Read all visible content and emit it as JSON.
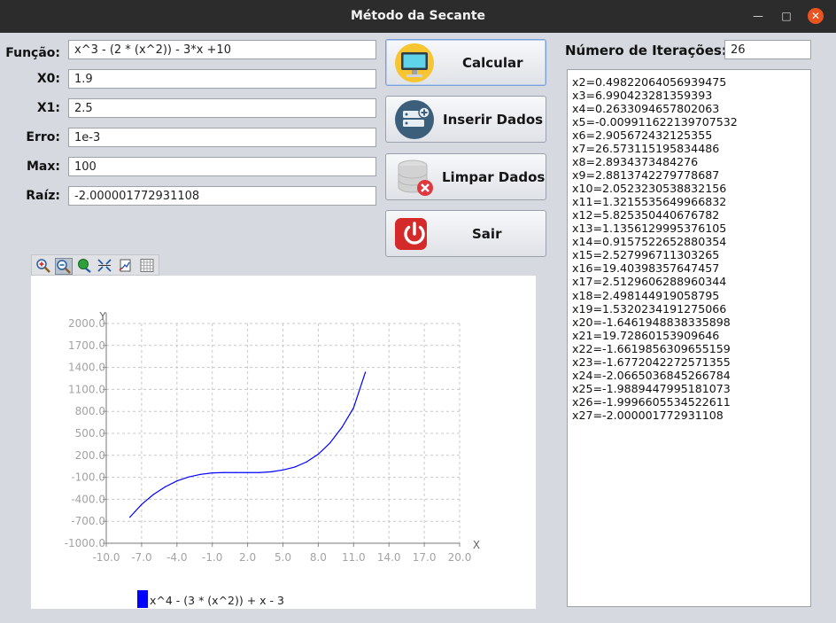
{
  "window": {
    "title": "Método da Secante"
  },
  "form": {
    "funcao": {
      "label": "Função:",
      "value": "x^3 - (2 * (x^2)) - 3*x +10"
    },
    "x0": {
      "label": "X0:",
      "value": "1.9"
    },
    "x1": {
      "label": "X1:",
      "value": "2.5"
    },
    "erro": {
      "label": "Erro:",
      "value": "1e-3"
    },
    "max": {
      "label": "Max:",
      "value": "100"
    },
    "raiz": {
      "label": "Raíz:",
      "value": "-2.000001772931108"
    }
  },
  "buttons": {
    "calcular": "Calcular",
    "inserir": "Inserir Dados",
    "limpar": "Limpar Dados",
    "sair": "Sair"
  },
  "iterations": {
    "label": "Número de Iterações:",
    "value": "26"
  },
  "output_lines": [
    "x2=0.49822064056939475",
    "x3=6.990423281359393",
    "x4=0.2633094657802063",
    "x5=-0.009911622139707532",
    "x6=2.905672432125355",
    "x7=26.573115195834486",
    "x8=2.8934373484276",
    "x9=2.8813742279778687",
    "x10=2.0523230538832156",
    "x11=1.3215535649966832",
    "x12=5.825350440676782",
    "x13=1.1356129995376105",
    "x14=0.9157522652880354",
    "x15=2.527996711303265",
    "x16=19.40398357647457",
    "x17=2.5129606288960344",
    "x18=2.498144919058795",
    "x19=1.5320234191275066",
    "x20=-1.6461948838335898",
    "x21=19.72860153909646",
    "x22=-1.6619856309655159",
    "x23=-1.6772042272571355",
    "x24=-2.0665036845266784",
    "x25=-1.9889447995181073",
    "x26=-1.9996605534522611",
    "x27=-2.000001772931108"
  ],
  "toolbar_icons": [
    "zoom-in-icon",
    "zoom-out-icon",
    "pan-icon",
    "autoscale-icon",
    "export-icon",
    "grid-icon"
  ],
  "chart_data": {
    "type": "line",
    "xlabel": "X",
    "ylabel": "Y",
    "xlim": [
      -10,
      20
    ],
    "ylim": [
      -1000,
      2000
    ],
    "x_ticks": [
      "-10.0",
      "-7.0",
      "-4.0",
      "-1.0",
      "2.0",
      "5.0",
      "8.0",
      "11.0",
      "14.0",
      "17.0",
      "20.0"
    ],
    "y_ticks": [
      "-1000.0",
      "-700.0",
      "-400.0",
      "-100.0",
      "200.0",
      "500.0",
      "800.0",
      "1100.0",
      "1400.0",
      "1700.0",
      "2000.0"
    ],
    "grid": true,
    "legend_position": "bottom",
    "series": [
      {
        "name": "x^4 - (3 * (x^2)) + x - 3",
        "color": "#0000ff",
        "x": [
          -8,
          -7,
          -6,
          -5,
          -4,
          -3,
          -2,
          -1,
          0,
          1,
          2,
          3,
          4,
          5,
          6,
          7,
          8,
          9,
          10,
          11,
          12
        ],
        "y": [
          -645,
          -470,
          -335,
          -230,
          -150,
          -95,
          -60,
          -40,
          -35,
          -35,
          -35,
          -35,
          -25,
          0,
          40,
          110,
          215,
          370,
          580,
          850,
          1335
        ]
      }
    ]
  }
}
